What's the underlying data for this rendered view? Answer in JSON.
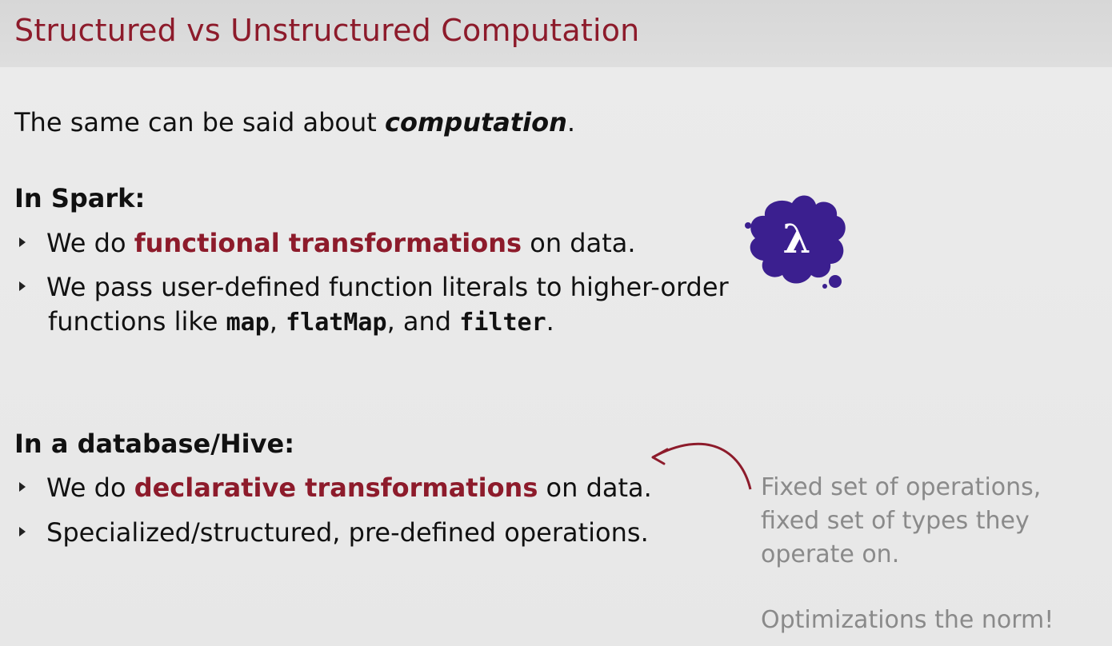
{
  "slide": {
    "title": "Structured vs Unstructured Computation",
    "intro": {
      "prefix": "The same can be said about ",
      "emphasis": "computation",
      "suffix": "."
    },
    "spark": {
      "heading": "In Spark:",
      "bullet1": {
        "prefix": "We do ",
        "highlight": "functional transformations",
        "suffix": " on data."
      },
      "bullet2": {
        "line1": "We pass user-defined function literals to higher-order",
        "line2_prefix": "functions like ",
        "code1": "map",
        "sep1": ", ",
        "code2": "flatMap",
        "sep2": ", and ",
        "code3": "filter",
        "end": "."
      },
      "logo_glyph": "λ"
    },
    "database": {
      "heading": "In a database/Hive:",
      "bullet1": {
        "prefix": "We do ",
        "highlight": "declarative transformations",
        "suffix": " on data."
      },
      "bullet2": "Specialized/structured, pre-defined operations."
    },
    "sidenote": {
      "line1": "Fixed set of operations,",
      "line2": "fixed set of types they",
      "line3": "operate on.",
      "line4": "Optimizations the norm!"
    },
    "colors": {
      "accent": "#8d1b2b",
      "logo": "#3b1f8f",
      "note": "#8a8a8a"
    }
  }
}
